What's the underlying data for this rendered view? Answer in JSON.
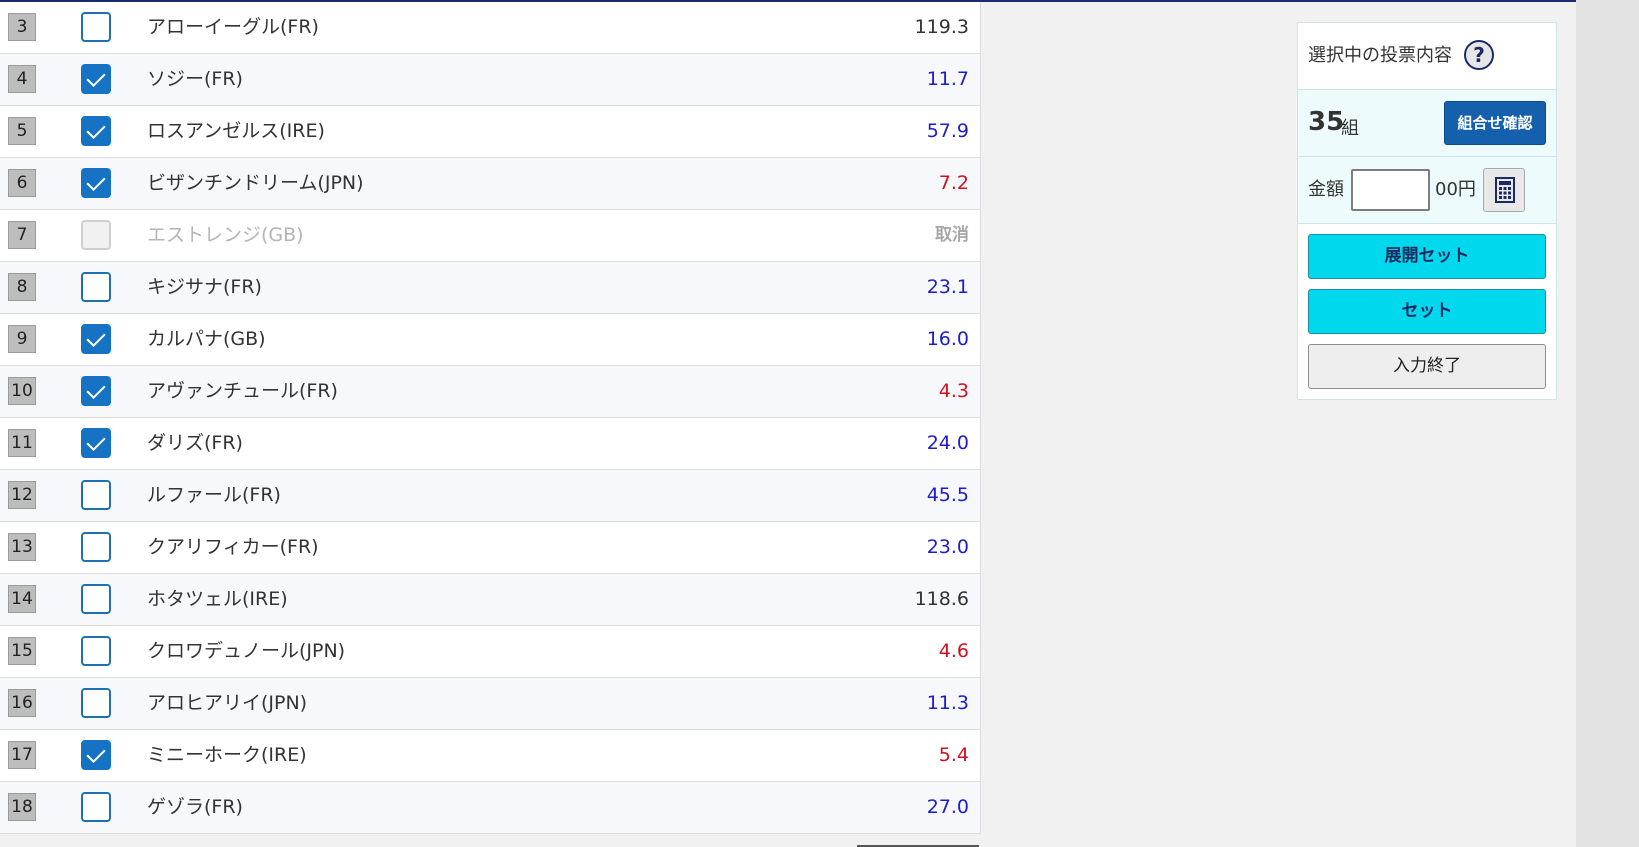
{
  "horses": [
    {
      "num": "3",
      "checked": false,
      "disabled": false,
      "name": "アローイーグル(FR)",
      "odds": "119.3",
      "odds_color": "black"
    },
    {
      "num": "4",
      "checked": true,
      "disabled": false,
      "name": "ソジー(FR)",
      "odds": "11.7",
      "odds_color": "blue"
    },
    {
      "num": "5",
      "checked": true,
      "disabled": false,
      "name": "ロスアンゼルス(IRE)",
      "odds": "57.9",
      "odds_color": "blue"
    },
    {
      "num": "6",
      "checked": true,
      "disabled": false,
      "name": "ビザンチンドリーム(JPN)",
      "odds": "7.2",
      "odds_color": "red"
    },
    {
      "num": "7",
      "checked": false,
      "disabled": true,
      "name": "エストレンジ(GB)",
      "odds": "取消",
      "odds_color": "cancel"
    },
    {
      "num": "8",
      "checked": false,
      "disabled": false,
      "name": "キジサナ(FR)",
      "odds": "23.1",
      "odds_color": "blue"
    },
    {
      "num": "9",
      "checked": true,
      "disabled": false,
      "name": "カルパナ(GB)",
      "odds": "16.0",
      "odds_color": "blue"
    },
    {
      "num": "10",
      "checked": true,
      "disabled": false,
      "name": "アヴァンチュール(FR)",
      "odds": "4.3",
      "odds_color": "red"
    },
    {
      "num": "11",
      "checked": true,
      "disabled": false,
      "name": "ダリズ(FR)",
      "odds": "24.0",
      "odds_color": "blue"
    },
    {
      "num": "12",
      "checked": false,
      "disabled": false,
      "name": "ルファール(FR)",
      "odds": "45.5",
      "odds_color": "blue"
    },
    {
      "num": "13",
      "checked": false,
      "disabled": false,
      "name": "クアリフィカー(FR)",
      "odds": "23.0",
      "odds_color": "blue"
    },
    {
      "num": "14",
      "checked": false,
      "disabled": false,
      "name": "ホタツェル(IRE)",
      "odds": "118.6",
      "odds_color": "black"
    },
    {
      "num": "15",
      "checked": false,
      "disabled": false,
      "name": "クロワデュノール(JPN)",
      "odds": "4.6",
      "odds_color": "red"
    },
    {
      "num": "16",
      "checked": false,
      "disabled": false,
      "name": "アロヒアリイ(JPN)",
      "odds": "11.3",
      "odds_color": "blue"
    },
    {
      "num": "17",
      "checked": true,
      "disabled": false,
      "name": "ミニーホーク(IRE)",
      "odds": "5.4",
      "odds_color": "red"
    },
    {
      "num": "18",
      "checked": false,
      "disabled": false,
      "name": "ゲゾラ(FR)",
      "odds": "27.0",
      "odds_color": "blue"
    }
  ],
  "panel": {
    "title": "選択中の投票内容",
    "help_icon": "question-icon",
    "count_value": "35",
    "count_unit": "組",
    "combo_button": "組合せ確認",
    "amount_label": "金額",
    "amount_value": "",
    "amount_unit": "00円",
    "calc_icon": "calculator-icon",
    "expand_set_button": "展開セット",
    "set_button": "セット",
    "finish_button": "入力終了"
  },
  "colors": {
    "checkbox": "#1673c4",
    "odds_blue": "#1c1ccc",
    "odds_red": "#d0101e",
    "action_cyan": "#00d8ee",
    "combo_blue": "#1560ad"
  }
}
